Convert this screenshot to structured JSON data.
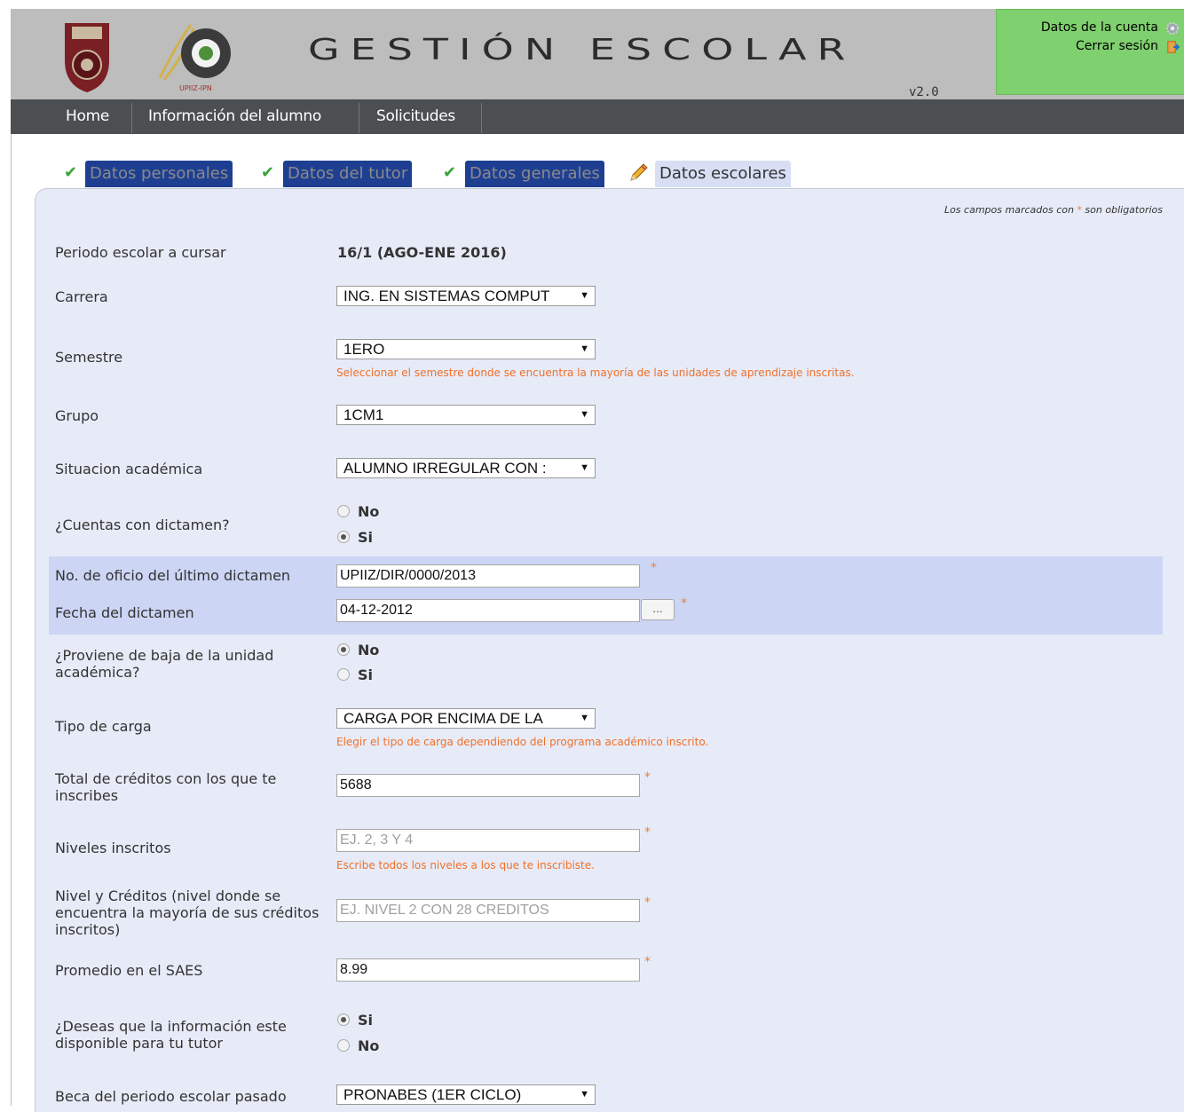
{
  "header": {
    "title": "GESTIÓN ESCOLAR",
    "version": "v2.0",
    "upiiz_label": "UPIIZ-IPN",
    "account": {
      "account_data": "Datos de la cuenta",
      "logout": "Cerrar sesión"
    }
  },
  "nav": {
    "items": [
      "Home",
      "Información del alumno",
      "Solicitudes"
    ]
  },
  "steps": [
    {
      "label": "Datos personales",
      "status": "done"
    },
    {
      "label": "Datos del tutor",
      "status": "done"
    },
    {
      "label": "Datos generales",
      "status": "done"
    },
    {
      "label": "Datos escolares",
      "status": "current"
    }
  ],
  "form": {
    "required_note_prefix": "Los campos marcados con ",
    "required_note_star": "*",
    "required_note_suffix": " son obligatorios",
    "periodo": {
      "label": "Periodo escolar a cursar",
      "value": "16/1 (AGO-ENE 2016)"
    },
    "carrera": {
      "label": "Carrera",
      "value": "ING. EN SISTEMAS COMPUT"
    },
    "semestre": {
      "label": "Semestre",
      "value": "1ERO",
      "hint": "Seleccionar el semestre donde se encuentra la mayoría de las unidades de aprendizaje inscritas."
    },
    "grupo": {
      "label": "Grupo",
      "value": "1CM1"
    },
    "situacion": {
      "label": "Situacion académica",
      "value": "ALUMNO IRREGULAR CON :"
    },
    "dictamen": {
      "label": "¿Cuentas con dictamen?",
      "options": [
        "No",
        "Si"
      ],
      "selected": "Si"
    },
    "oficio": {
      "label": "No. de oficio del último dictamen",
      "value": "UPIIZ/DIR/0000/2013"
    },
    "fecha": {
      "label": "Fecha del dictamen",
      "value": "04-12-2012",
      "button": "..."
    },
    "baja": {
      "label": "¿Proviene de baja de la unidad académica?",
      "options": [
        "No",
        "Si"
      ],
      "selected": "No"
    },
    "carga": {
      "label": "Tipo de carga",
      "value": "CARGA POR ENCIMA DE LA",
      "hint": "Elegir el tipo de carga dependiendo del programa académico inscrito."
    },
    "creditos": {
      "label": "Total de créditos con los que te inscribes",
      "value": "5688"
    },
    "niveles": {
      "label": "Niveles inscritos",
      "placeholder": "EJ. 2, 3 Y 4",
      "hint": "Escribe todos los niveles a los que te inscribiste."
    },
    "nivel_creditos": {
      "label": "Nivel y Créditos (nivel donde se encuentra la mayoría de sus créditos inscritos)",
      "placeholder": "EJ. NIVEL 2 CON 28 CREDITOS"
    },
    "promedio": {
      "label": "Promedio en el SAES",
      "value": "8.99"
    },
    "tutor_info": {
      "label": "¿Deseas que la información este disponible para tu tutor",
      "options": [
        "Si",
        "No"
      ],
      "selected": "Si"
    },
    "beca": {
      "label": "Beca del periodo escolar pasado",
      "value": "PRONABES (1ER CICLO)"
    },
    "required_star": "*"
  }
}
